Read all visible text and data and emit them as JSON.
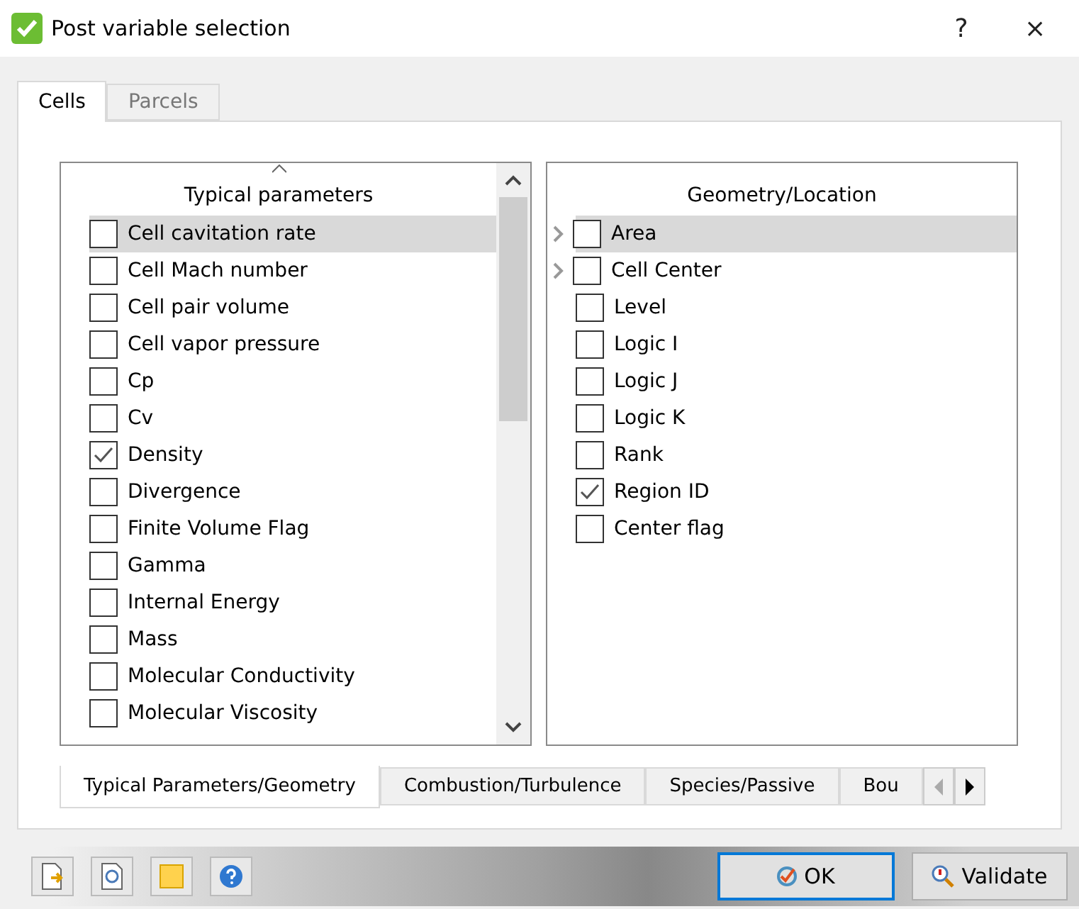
{
  "window": {
    "title": "Post variable selection",
    "help": "?",
    "close": "×"
  },
  "tabs": [
    {
      "label": "Cells",
      "selected": true
    },
    {
      "label": "Parcels",
      "selected": false
    }
  ],
  "lists": [
    {
      "title": "Typical parameters",
      "sortable": true,
      "scrollbar": true,
      "items": [
        {
          "label": "Cell cavitation rate",
          "checked": false,
          "highlighted": true,
          "expandable": false
        },
        {
          "label": "Cell Mach number",
          "checked": false,
          "highlighted": false,
          "expandable": false
        },
        {
          "label": "Cell pair volume",
          "checked": false,
          "highlighted": false,
          "expandable": false
        },
        {
          "label": "Cell vapor pressure",
          "checked": false,
          "highlighted": false,
          "expandable": false
        },
        {
          "label": "Cp",
          "checked": false,
          "highlighted": false,
          "expandable": false
        },
        {
          "label": "Cv",
          "checked": false,
          "highlighted": false,
          "expandable": false
        },
        {
          "label": "Density",
          "checked": true,
          "highlighted": false,
          "expandable": false
        },
        {
          "label": "Divergence",
          "checked": false,
          "highlighted": false,
          "expandable": false
        },
        {
          "label": "Finite Volume Flag",
          "checked": false,
          "highlighted": false,
          "expandable": false
        },
        {
          "label": "Gamma",
          "checked": false,
          "highlighted": false,
          "expandable": false
        },
        {
          "label": "Internal Energy",
          "checked": false,
          "highlighted": false,
          "expandable": false
        },
        {
          "label": "Mass",
          "checked": false,
          "highlighted": false,
          "expandable": false
        },
        {
          "label": "Molecular Conductivity",
          "checked": false,
          "highlighted": false,
          "expandable": false
        },
        {
          "label": "Molecular Viscosity",
          "checked": false,
          "highlighted": false,
          "expandable": false
        }
      ]
    },
    {
      "title": "Geometry/Location",
      "sortable": false,
      "scrollbar": false,
      "items": [
        {
          "label": "Area",
          "checked": false,
          "highlighted": true,
          "expandable": true
        },
        {
          "label": "Cell Center",
          "checked": false,
          "highlighted": false,
          "expandable": true
        },
        {
          "label": "Level",
          "checked": false,
          "highlighted": false,
          "expandable": false
        },
        {
          "label": "Logic I",
          "checked": false,
          "highlighted": false,
          "expandable": false
        },
        {
          "label": "Logic J",
          "checked": false,
          "highlighted": false,
          "expandable": false
        },
        {
          "label": "Logic K",
          "checked": false,
          "highlighted": false,
          "expandable": false
        },
        {
          "label": "Rank",
          "checked": false,
          "highlighted": false,
          "expandable": false
        },
        {
          "label": "Region ID",
          "checked": true,
          "highlighted": false,
          "expandable": false
        },
        {
          "label": "Center flag",
          "checked": false,
          "highlighted": false,
          "expandable": false
        }
      ]
    }
  ],
  "category_tabs": [
    {
      "label": "Typical Parameters/Geometry",
      "selected": true
    },
    {
      "label": "Combustion/Turbulence",
      "selected": false
    },
    {
      "label": "Species/Passive",
      "selected": false
    },
    {
      "label": "Bou",
      "selected": false
    }
  ],
  "buttons": [
    {
      "label": "OK",
      "kind": "ok",
      "default": true
    },
    {
      "label": "Validate",
      "kind": "validate",
      "default": false
    }
  ]
}
